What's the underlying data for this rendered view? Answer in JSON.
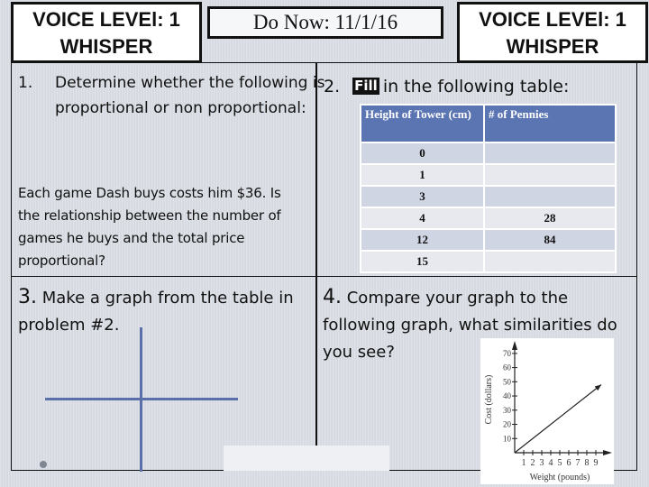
{
  "header": {
    "voice_level_left": {
      "line1": "VOICE LEVEl: 1",
      "line2": "WHISPER"
    },
    "do_now": "Do Now: 11/1/16",
    "voice_level_right": {
      "line1": "VOICE LEVEl: 1",
      "line2": "WHISPER"
    }
  },
  "problem1": {
    "number": "1.",
    "prompt": "Determine whether the following is proportional or non proportional:",
    "story": "Each game Dash buys costs him $36. Is the relationship between the number of games he buys and the total price proportional?"
  },
  "problem2": {
    "number": "2.",
    "fill_icon_text": "Fill",
    "prompt": "in the following table:",
    "table": {
      "headers": [
        "Height of Tower (cm)",
        "# of Pennies"
      ],
      "rows": [
        [
          "0",
          ""
        ],
        [
          "1",
          ""
        ],
        [
          "3",
          ""
        ],
        [
          "4",
          "28"
        ],
        [
          "12",
          "84"
        ],
        [
          "15",
          ""
        ]
      ]
    }
  },
  "problem3": {
    "number": "3.",
    "prompt": "Make a graph from the table in problem #2."
  },
  "problem4": {
    "number": "4.",
    "prompt": "Compare your graph to the following graph, what similarities do you see?"
  },
  "chart_data": {
    "type": "line",
    "title": "",
    "xlabel": "Weight (pounds)",
    "ylabel": "Cost (dollars)",
    "x_ticks": [
      1,
      2,
      3,
      4,
      5,
      6,
      7,
      8,
      9
    ],
    "y_ticks": [
      10,
      20,
      30,
      40,
      50,
      60,
      70
    ],
    "xlim": [
      0,
      10
    ],
    "ylim": [
      0,
      75
    ],
    "grid": false,
    "series": [
      {
        "name": "cost",
        "x": [
          0,
          9.6
        ],
        "y": [
          0,
          48
        ],
        "arrow_end": true
      }
    ]
  }
}
